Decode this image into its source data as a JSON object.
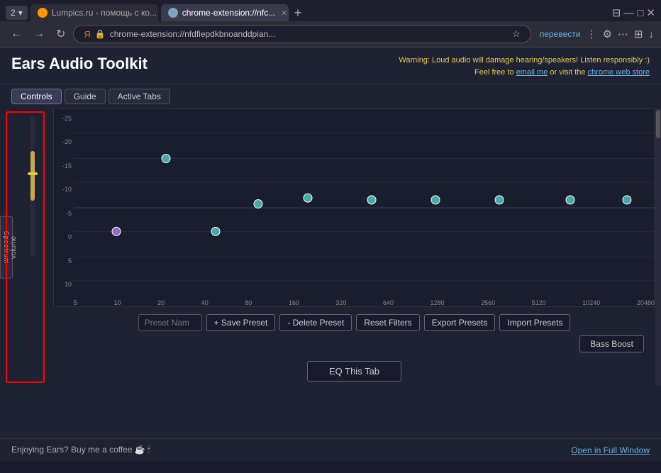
{
  "browser": {
    "tab1_label": "Lumpics.ru - помощь с ко...",
    "tab2_label": "chrome-extension://nfc...",
    "address": "chrome-extension://nfdfiepdkbnoanddpian...",
    "translate_btn": "перевести"
  },
  "app": {
    "title": "Ears Audio Toolkit",
    "warning": "Warning: Loud audio will damage hearing/speakers! Listen responsibly :)",
    "warning_sub": "Feel free to ",
    "email_link": "email me",
    "or_visit": " or visit the ",
    "store_link": "chrome web store",
    "tabs": [
      "Controls",
      "Guide",
      "Active Tabs"
    ],
    "spectrum_btn": "Spectrum",
    "volume_label": "volume",
    "preset_name_placeholder": "Preset Nam",
    "save_preset": "+ Save Preset",
    "delete_preset": "- Delete Preset",
    "reset_filters": "Reset Filters",
    "export_presets": "Export Presets",
    "import_presets": "Import Presets",
    "bass_boost": "Bass Boost",
    "eq_this_tab": "EQ This Tab",
    "footer_left": "Enjoying Ears? Buy me a coffee ☕ 🕯",
    "footer_right": "Open in Full Window",
    "y_labels": [
      "-25",
      "-20",
      "-15",
      "-10",
      "-5",
      "0",
      "5",
      "10"
    ],
    "x_labels": [
      "5",
      "10",
      "20",
      "40",
      "80",
      "160",
      "320",
      "640",
      "1280",
      "2560",
      "5120",
      "10240",
      "20480"
    ]
  }
}
